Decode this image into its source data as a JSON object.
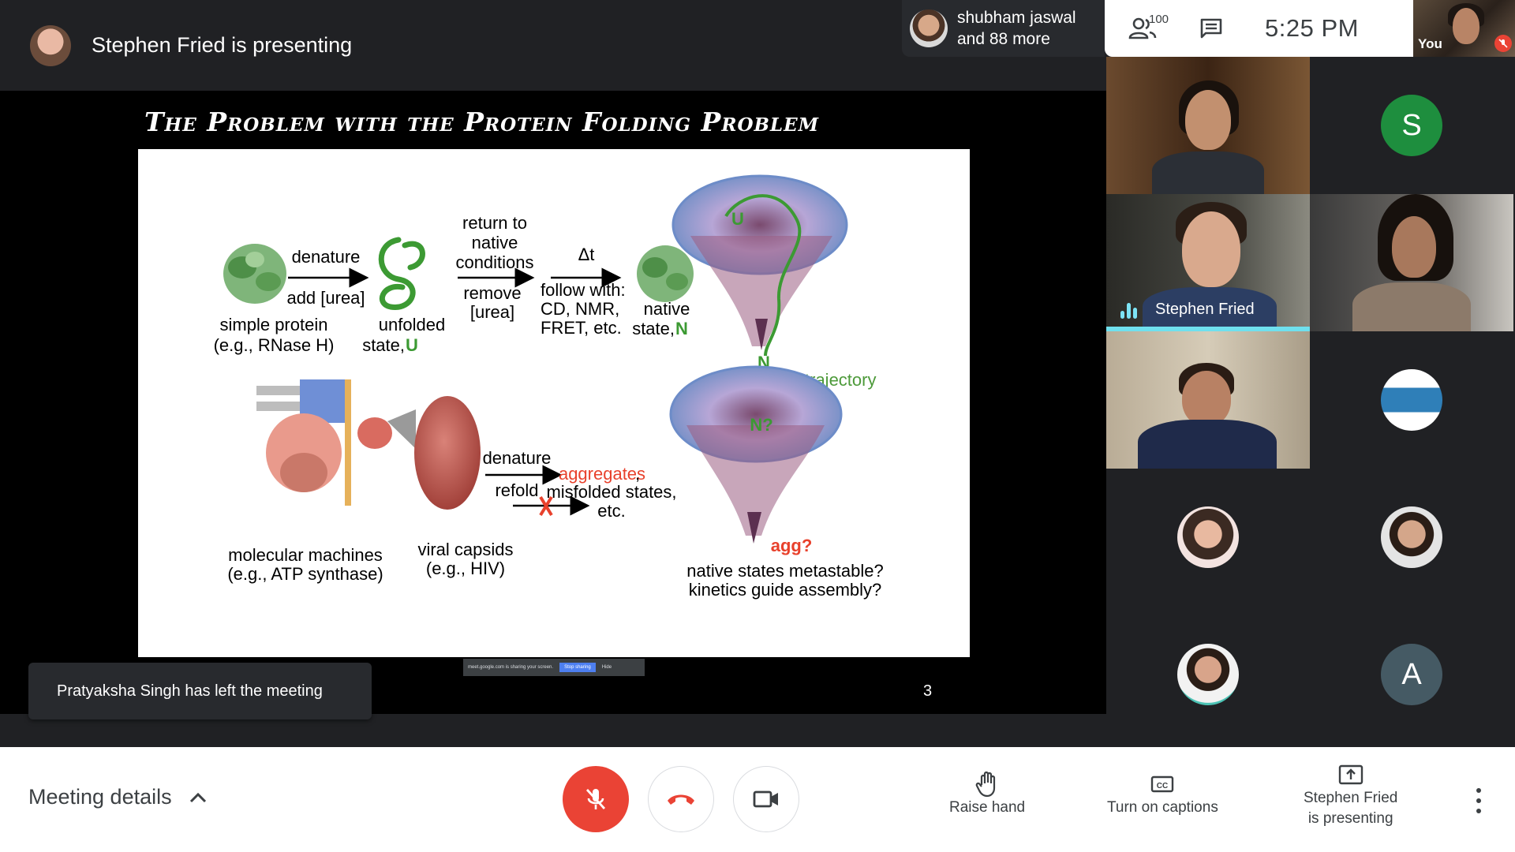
{
  "header": {
    "presenting_text": "Stephen Fried is presenting",
    "participants_chip": {
      "line1": "shubham jaswal",
      "line2": "and 88 more"
    },
    "people_count": "100",
    "time": "5:25 PM",
    "self_label": "You"
  },
  "slide": {
    "title": "The Problem with the Protein Folding Problem",
    "top": {
      "arrow1_top": "denature",
      "arrow1_bottom": "add [urea]",
      "label_simple_1": "simple protein",
      "label_simple_2": "(e.g., RNase H)",
      "label_unfolded_1": "unfolded",
      "label_unfolded_2": "state, ",
      "label_unfolded_3": "U",
      "return_1": "return to",
      "return_2": "native",
      "return_3": "conditions",
      "remove_1": "remove",
      "remove_2": "[urea]",
      "delta_t": "Δt",
      "follow_1": "follow with:",
      "follow_2": "CD, NMR,",
      "follow_3": "FRET, etc.",
      "native_1": "native",
      "native_2": "state, ",
      "native_3": "N",
      "funnel_u": "U",
      "funnel_n": "N",
      "refolding": "refolding trajectory"
    },
    "bottom": {
      "denature": "denature",
      "refold": "refold",
      "aggregates": "aggregates",
      "aggregates_comma": ",",
      "misfolded": "misfolded states,",
      "etc": "etc.",
      "machines_1": "molecular machines",
      "machines_2": "(e.g., ATP synthase)",
      "capsids_1": "viral capsids",
      "capsids_2": "(e.g., HIV)",
      "funnel_n": "N?",
      "funnel_agg": "agg?",
      "question_1": "native states metastable?",
      "question_2": "kinetics guide assembly?"
    },
    "number": "3"
  },
  "share_bar": {
    "text": "meet.google.com is sharing your screen.",
    "stop": "Stop sharing",
    "hide": "Hide"
  },
  "toast": "Pratyaksha Singh has left the meeting",
  "tiles": {
    "speaker_name": "Stephen Fried",
    "s_letter": "S",
    "a_letter": "A"
  },
  "bottom_bar": {
    "meeting_details": "Meeting details",
    "raise_hand": "Raise hand",
    "captions": "Turn on captions",
    "presenting_1": "Stephen Fried",
    "presenting_2": "is presenting"
  },
  "colors": {
    "accent_red": "#ea4335",
    "speaking_cyan": "#6fe0ee",
    "avatar_green": "#1e8e3e",
    "avatar_slate": "#455a64",
    "slide_green": "#4d9a3a",
    "slide_red": "#e8412c"
  }
}
